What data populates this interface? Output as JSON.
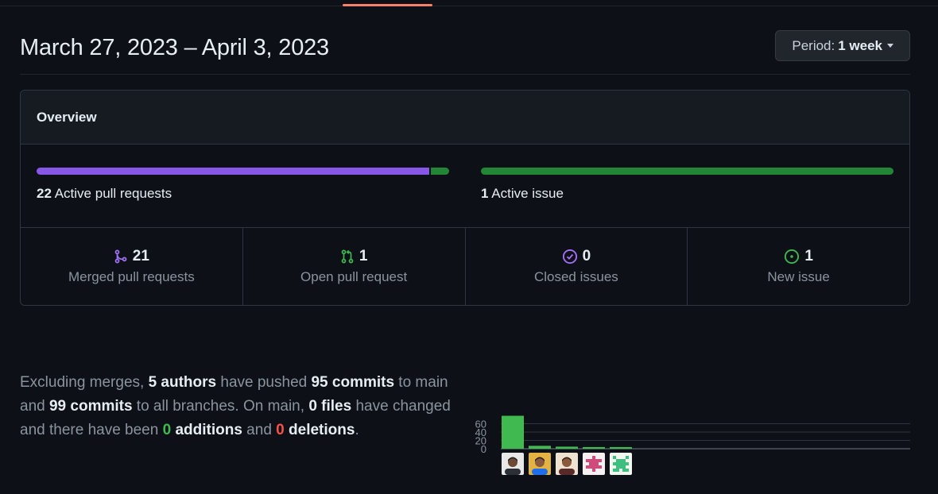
{
  "header": {
    "date_range": "March 27, 2023 – April 3, 2023",
    "period_label": "Period:",
    "period_value": "1 week"
  },
  "overview": {
    "title": "Overview",
    "active_pull_requests": {
      "count": "22",
      "label": "Active pull requests",
      "merged_fraction": 0.955
    },
    "active_issues": {
      "count": "1",
      "label": "Active issue"
    },
    "stats": [
      {
        "icon": "git-merge-icon",
        "value": "21",
        "label": "Merged pull requests",
        "color": "#a371f7"
      },
      {
        "icon": "git-pull-request-icon",
        "value": "1",
        "label": "Open pull request",
        "color": "#3fb950"
      },
      {
        "icon": "issue-closed-icon",
        "value": "0",
        "label": "Closed issues",
        "color": "#a371f7"
      },
      {
        "icon": "issue-opened-icon",
        "value": "1",
        "label": "New issue",
        "color": "#3fb950"
      }
    ]
  },
  "summary": {
    "p1": "Excluding merges, ",
    "authors": "5 authors",
    "p2": " have pushed ",
    "commits_main": "95 commits",
    "p3": " to main and ",
    "commits_all": "99 commits",
    "p4": " to all branches. On main, ",
    "files": "0 files",
    "p5": " have changed and there have been ",
    "additions_num": "0",
    "additions_word": " additions",
    "p6": " and ",
    "deletions_num": "0",
    "deletions_word": " deletions",
    "p7": "."
  },
  "chart_data": {
    "type": "bar",
    "categories": [
      "author-1",
      "author-2",
      "author-3",
      "author-4",
      "author-5"
    ],
    "values": [
      79,
      7,
      5,
      4,
      4
    ],
    "yticks": [
      "0",
      "20",
      "40",
      "60"
    ],
    "ylim": [
      0,
      80
    ],
    "bar_color": "#3fb950",
    "grid": true
  }
}
